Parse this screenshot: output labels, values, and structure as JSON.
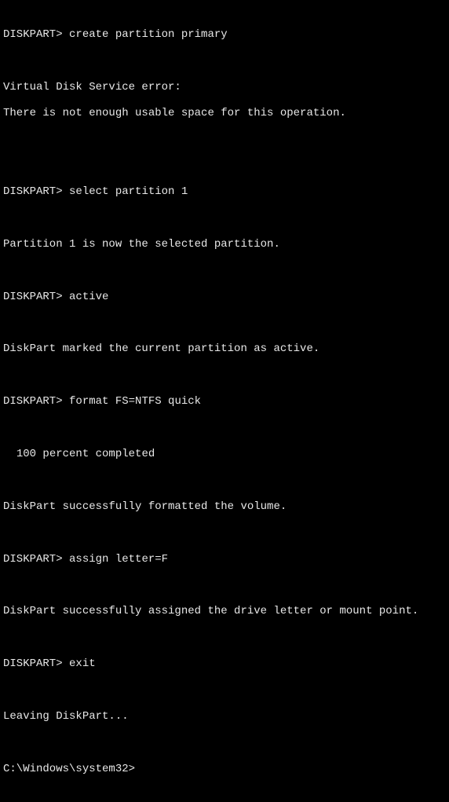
{
  "prompts": {
    "diskpart": "DISKPART>",
    "system32": "C:\\Windows\\system32>"
  },
  "commands": {
    "create_partition": "create partition primary",
    "select_partition": "select partition 1",
    "active": "active",
    "format": "format FS=NTFS quick",
    "assign": "assign letter=F",
    "exit": "exit"
  },
  "outputs": {
    "error_header": "Virtual Disk Service error:",
    "error_msg": "There is not enough usable space for this operation.",
    "selected": "Partition 1 is now the selected partition.",
    "active_result": "DiskPart marked the current partition as active.",
    "percent": "  100 percent completed",
    "format_result": "DiskPart successfully formatted the volume.",
    "assign_result": "DiskPart successfully assigned the drive letter or mount point.",
    "leaving": "Leaving DiskPart..."
  }
}
